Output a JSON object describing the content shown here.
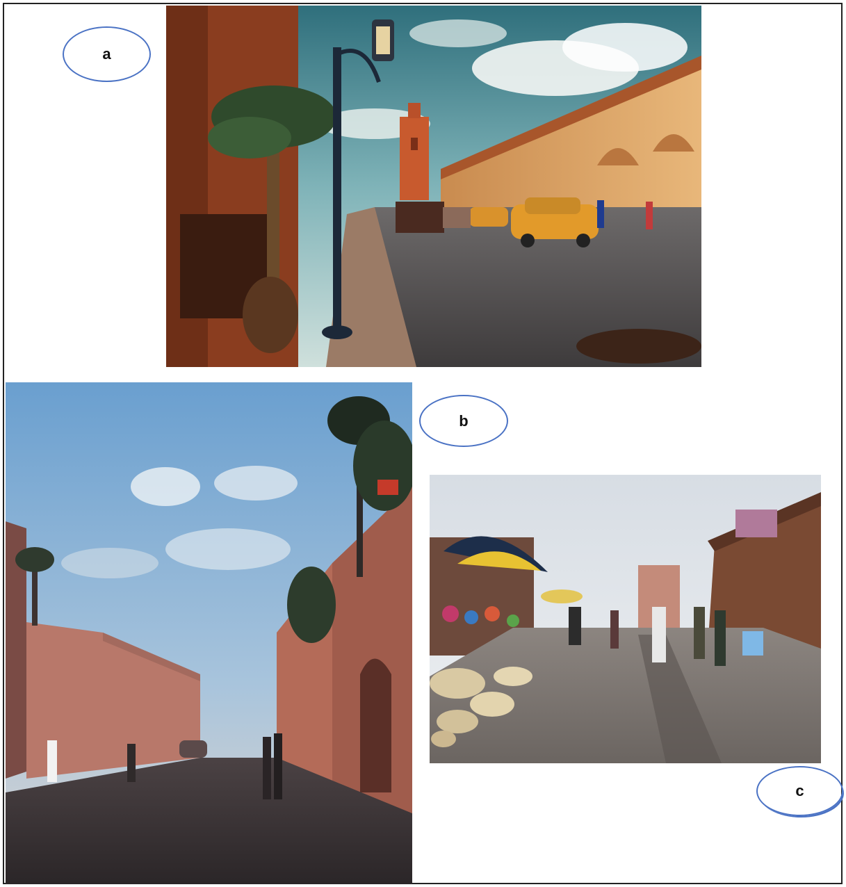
{
  "figure": {
    "labels": {
      "a": "a",
      "b": "b",
      "c": "c"
    },
    "colors": {
      "label_outline": "#4a72c4",
      "frame_border": "#222222"
    },
    "photos": [
      {
        "id": "a",
        "scene": "sunny-street-with-lamp-post-minaret-taxis-horse-carriage"
      },
      {
        "id": "b",
        "scene": "dusk-street-with-pink-walls-palm-trees"
      },
      {
        "id": "c",
        "scene": "market-street-with-umbrellas-and-baskets"
      }
    ]
  }
}
